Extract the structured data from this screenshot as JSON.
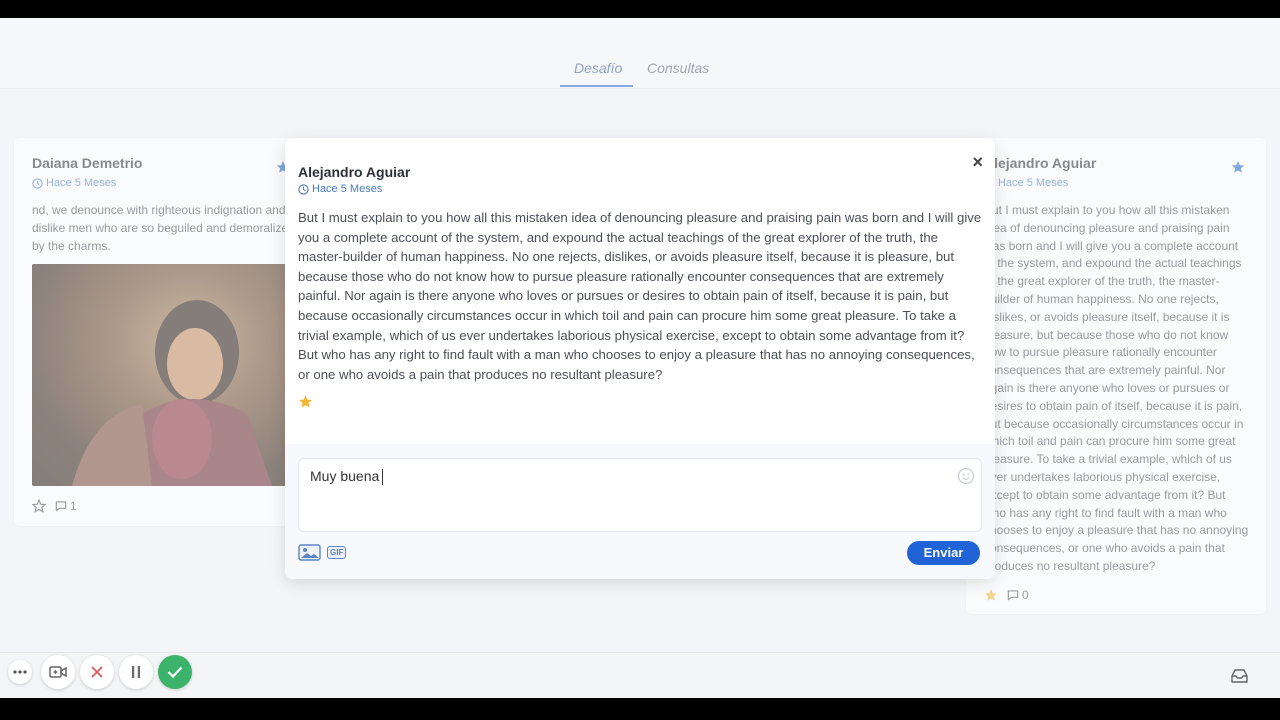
{
  "tabs": [
    {
      "label": "Desafío"
    },
    {
      "label": "Consultas"
    }
  ],
  "left_card": {
    "author": "Daiana Demetrio",
    "time": "Hace 5 Meses",
    "text": "nd, we denounce with righteous indignation and dislike men who are so beguiled and demoralized by the charms.",
    "comments": "1"
  },
  "right_card": {
    "author": "Alejandro Aguiar",
    "time": "Hace 5 Meses",
    "text": "But I must explain to you how all this mistaken idea of denouncing pleasure and praising pain was born and I will give you a complete account of the system, and expound the actual teachings of the great explorer of the truth, the master-builder of human happiness. No one rejects, dislikes, or avoids pleasure itself, because it is pleasure, but because those who do not know how to pursue pleasure rationally encounter consequences that are extremely painful. Nor again is there anyone who loves or pursues or desires to obtain pain of itself, because it is pain, but because occasionally circumstances occur in which toil and pain can procure him some great pleasure. To take a trivial example, which of us ever undertakes laborious physical exercise, except to obtain some advantage from it? But who has any right to find fault with a man who chooses to enjoy a pleasure that has no annoying consequences, or one who avoids a pain that produces no resultant pleasure?",
    "comments": "0"
  },
  "modal": {
    "author": "Alejandro Aguiar",
    "time": "Hace 5 Meses",
    "close": "×",
    "text": "But I must explain to you how all this mistaken idea of denouncing pleasure and praising pain was born and I will give you a complete account of the system, and expound the actual teachings of the great explorer of the truth, the master-builder of human happiness. No one rejects, dislikes, or avoids pleasure itself, because it is pleasure, but because those who do not know how to pursue pleasure rationally encounter consequences that are extremely painful. Nor again is there anyone who loves or pursues or desires to obtain pain of itself, because it is pain, but because occasionally circumstances occur in which toil and pain can procure him some great pleasure. To take a trivial example, which of us ever undertakes laborious physical exercise, except to obtain some advantage from it? But who has any right to find fault with a man who chooses to enjoy a pleasure that has no annoying consequences, or one who avoids a pain that produces no resultant pleasure?",
    "reply_value": "Muy buena",
    "gif_label": "GIF",
    "send_label": "Enviar"
  },
  "colors": {
    "accent": "#1f63d6",
    "star_filled": "#f2b636",
    "star_blue": "#2466c8",
    "confirm": "#3bb36a",
    "cancel": "#e05a5a"
  },
  "icons": [
    "clock-icon",
    "star-icon",
    "comment-icon",
    "close-icon",
    "emoji-icon",
    "image-icon",
    "gif-icon",
    "more-icon",
    "video-icon",
    "cancel-icon",
    "pause-icon",
    "check-icon",
    "inbox-icon"
  ]
}
